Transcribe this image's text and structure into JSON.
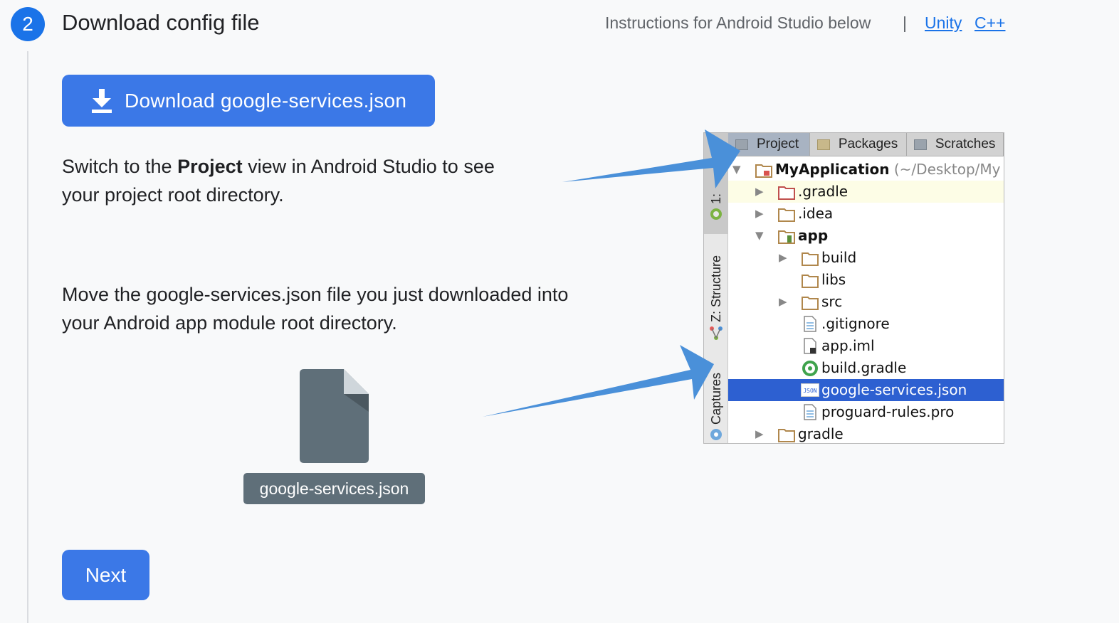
{
  "header": {
    "step_number": "2",
    "title": "Download config file",
    "instructions": "Instructions for Android Studio below",
    "separator": "|",
    "link_unity": "Unity",
    "link_cpp": "C++"
  },
  "download_button": {
    "label": "Download google-services.json"
  },
  "paragraph1": {
    "before": "Switch to the ",
    "bold": "Project",
    "after": " view in Android Studio to see your project root directory."
  },
  "paragraph2": "Move the google-services.json file you just downloaded into your Android app module root directory.",
  "file_tile": {
    "label": "google-services.json"
  },
  "next_button": {
    "label": "Next"
  },
  "ide": {
    "side_labels": [
      "1:",
      "Z: Structure",
      "Captures"
    ],
    "tabs": [
      "Project",
      "Packages",
      "Scratches"
    ],
    "root": {
      "name": "MyApplication",
      "path": "(~/Desktop/My"
    },
    "tree": [
      {
        "name": ".gradle",
        "kind": "folder-red"
      },
      {
        "name": ".idea",
        "kind": "folder"
      },
      {
        "name": "app",
        "kind": "module"
      },
      {
        "name": "build",
        "kind": "folder"
      },
      {
        "name": "libs",
        "kind": "folder"
      },
      {
        "name": "src",
        "kind": "folder"
      },
      {
        "name": ".gitignore",
        "kind": "file"
      },
      {
        "name": "app.iml",
        "kind": "iml"
      },
      {
        "name": "build.gradle",
        "kind": "gradle"
      },
      {
        "name": "google-services.json",
        "kind": "json",
        "selected": true
      },
      {
        "name": "proguard-rules.pro",
        "kind": "file"
      },
      {
        "name": "gradle",
        "kind": "folder"
      }
    ]
  },
  "colors": {
    "accent": "#1a73e8",
    "button": "#3b78e7",
    "arrow": "#4a90d9",
    "selection": "#2d60d1"
  }
}
